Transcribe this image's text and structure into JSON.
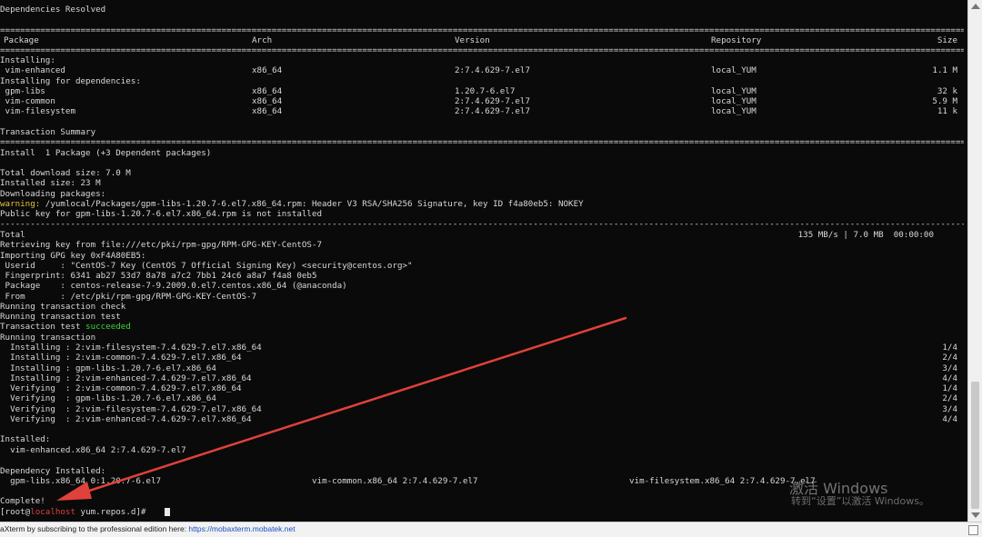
{
  "terminal": {
    "header_lines": [
      "Dependencies Resolved"
    ],
    "separator": "================================================================================================================================================================================================",
    "dash_separator": "------------------------------------------------------------------------------------------------------------------------------------------------------------------------------------------------",
    "table": {
      "headers": {
        "package": "Package",
        "arch": "Arch",
        "version": "Version",
        "repository": "Repository",
        "size": "Size"
      },
      "installing_label": "Installing:",
      "installing": [
        {
          "package": " vim-enhanced",
          "arch": "x86_64",
          "version": "2:7.4.629-7.el7",
          "repository": "local_YUM",
          "size": "1.1 M"
        }
      ],
      "deps_label": "Installing for dependencies:",
      "deps": [
        {
          "package": " gpm-libs",
          "arch": "x86_64",
          "version": "1.20.7-6.el7",
          "repository": "local_YUM",
          "size": "32 k"
        },
        {
          "package": " vim-common",
          "arch": "x86_64",
          "version": "2:7.4.629-7.el7",
          "repository": "local_YUM",
          "size": "5.9 M"
        },
        {
          "package": " vim-filesystem",
          "arch": "x86_64",
          "version": "2:7.4.629-7.el7",
          "repository": "local_YUM",
          "size": "11 k"
        }
      ]
    },
    "summary_title": "Transaction Summary",
    "install_line": "Install  1 Package (+3 Dependent packages)",
    "download_lines": [
      "Total download size: 7.0 M",
      "Installed size: 23 M",
      "Downloading packages:"
    ],
    "warning_prefix": "warning:",
    "warning_text": " /yumlocal/Packages/gpm-libs-1.20.7-6.el7.x86_64.rpm: Header V3 RSA/SHA256 Signature, key ID f4a80eb5: NOKEY",
    "pubkey_line": "Public key for gpm-libs-1.20.7-6.el7.x86_64.rpm is not installed",
    "total_label": "Total",
    "total_stats": "135 MB/s | 7.0 MB  00:00:00",
    "gpg_lines": [
      "Retrieving key from file:///etc/pki/rpm-gpg/RPM-GPG-KEY-CentOS-7",
      "Importing GPG key 0xF4A80EB5:",
      " Userid     : \"CentOS-7 Key (CentOS 7 Official Signing Key) <security@centos.org>\"",
      " Fingerprint: 6341 ab27 53d7 8a78 a7c2 7bb1 24c6 a8a7 f4a8 0eb5",
      " Package    : centos-release-7-9.2009.0.el7.centos.x86_64 (@anaconda)",
      " From       : /etc/pki/rpm-gpg/RPM-GPG-KEY-CentOS-7",
      "Running transaction check",
      "Running transaction test"
    ],
    "test_prefix": "Transaction test ",
    "test_status": "succeeded",
    "running_line": "Running transaction",
    "steps": [
      {
        "text": "  Installing : 2:vim-filesystem-7.4.629-7.el7.x86_64",
        "count": "1/4"
      },
      {
        "text": "  Installing : 2:vim-common-7.4.629-7.el7.x86_64",
        "count": "2/4"
      },
      {
        "text": "  Installing : gpm-libs-1.20.7-6.el7.x86_64",
        "count": "3/4"
      },
      {
        "text": "  Installing : 2:vim-enhanced-7.4.629-7.el7.x86_64",
        "count": "4/4"
      },
      {
        "text": "  Verifying  : 2:vim-common-7.4.629-7.el7.x86_64",
        "count": "1/4"
      },
      {
        "text": "  Verifying  : gpm-libs-1.20.7-6.el7.x86_64",
        "count": "2/4"
      },
      {
        "text": "  Verifying  : 2:vim-filesystem-7.4.629-7.el7.x86_64",
        "count": "3/4"
      },
      {
        "text": "  Verifying  : 2:vim-enhanced-7.4.629-7.el7.x86_64",
        "count": "4/4"
      }
    ],
    "installed_label": "Installed:",
    "installed_item": "  vim-enhanced.x86_64 2:7.4.629-7.el7",
    "dep_installed_label": "Dependency Installed:",
    "dep_installed_items": [
      "  gpm-libs.x86_64 0:1.20.7-6.el7",
      "vim-common.x86_64 2:7.4.629-7.el7",
      "vim-filesystem.x86_64 2:7.4.629-7.el7"
    ],
    "complete_line": "Complete!",
    "prompt": {
      "open": "[root@",
      "host": "localhost",
      "rest": " yum.repos.d]# "
    }
  },
  "watermark": {
    "line1": "激活 Windows",
    "line2": "转到“设置”以激活 Windows。"
  },
  "statusbar": {
    "text": "aXterm by subscribing to the professional edition here: ",
    "link": "https://mobaxterm.mobatek.net"
  },
  "colors": {
    "background": "#0a0a0a",
    "text": "#d8d8d8",
    "warning": "#e3c23c",
    "success": "#40d040",
    "host": "#e04040",
    "arrow": "#e0413a"
  }
}
